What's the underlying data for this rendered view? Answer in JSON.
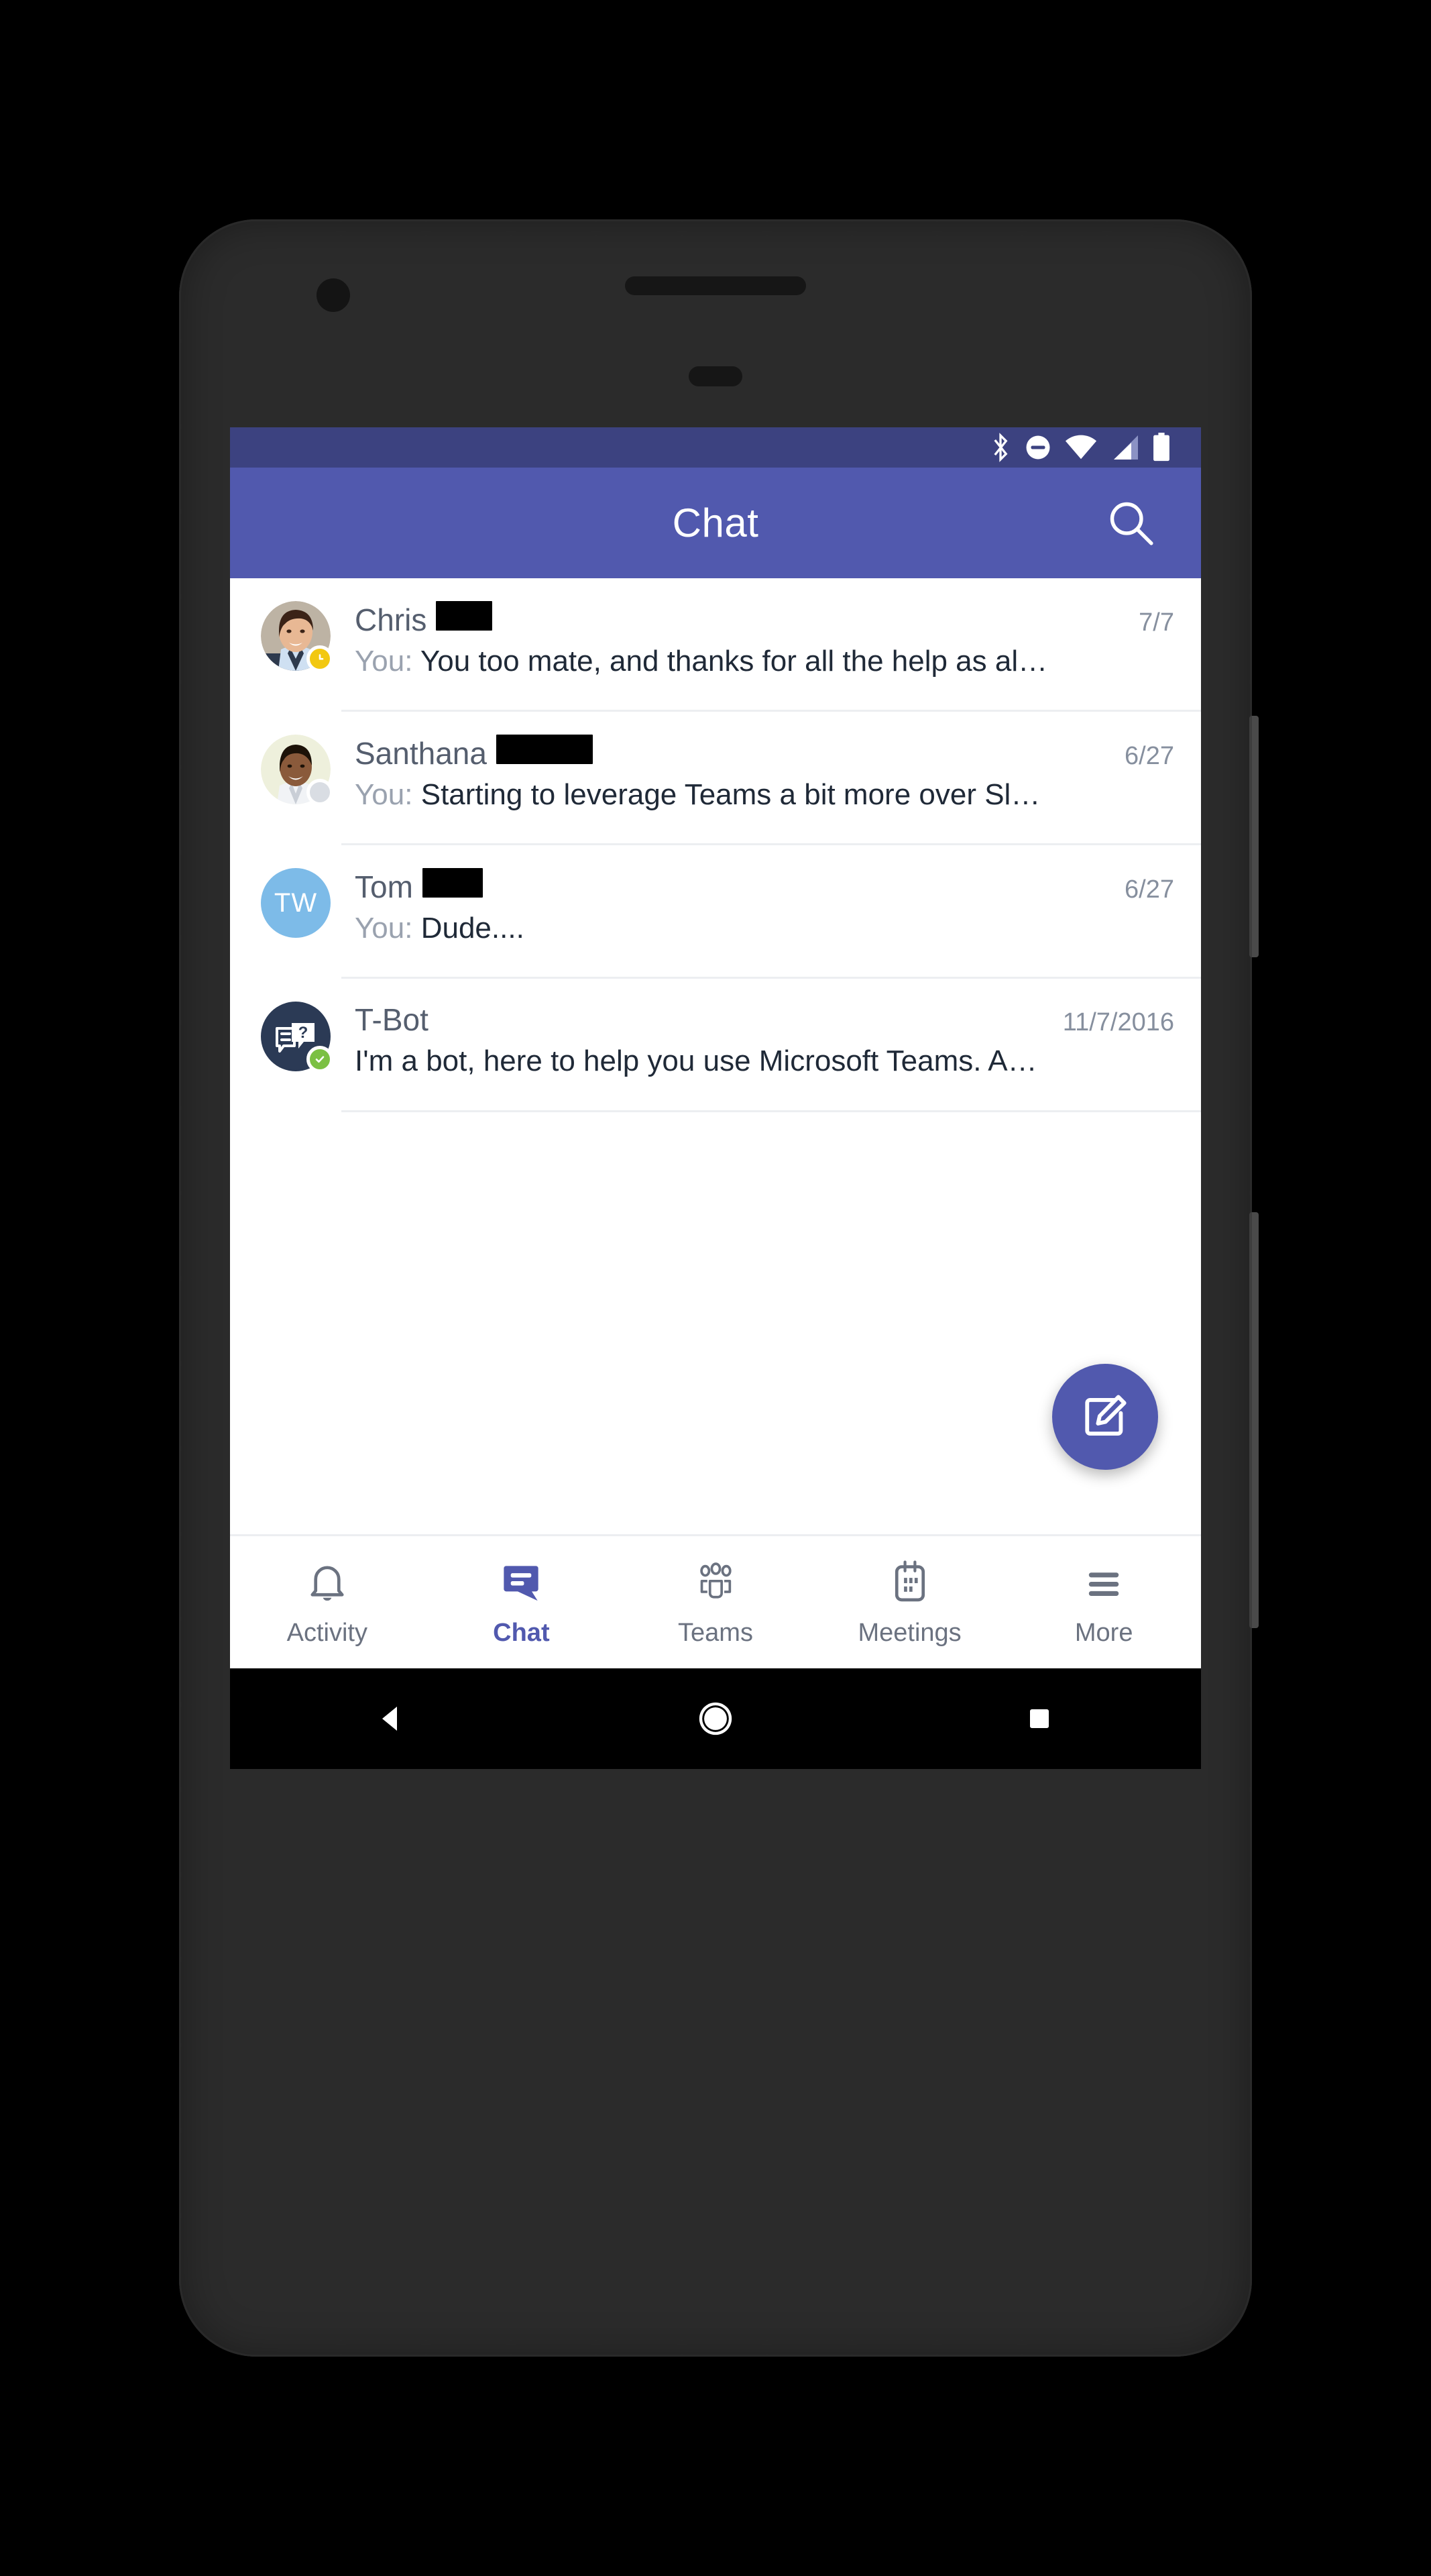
{
  "statusbar": {
    "icons": [
      "bluetooth-icon",
      "do-not-disturb-icon",
      "wifi-icon",
      "cellular-signal-icon",
      "battery-icon"
    ],
    "background": "#3c4280"
  },
  "appbar": {
    "title": "Chat",
    "search_icon": "search-icon",
    "background": "#5159ae"
  },
  "chat_list": [
    {
      "name": "Chris",
      "redacted": true,
      "redact_width": 84,
      "date": "7/7",
      "preview_prefix": "You:",
      "preview": "You too mate, and thanks for all the help as al…",
      "avatar_type": "photo",
      "avatar_initials": "",
      "presence": "away",
      "presence_color": "#f2c811"
    },
    {
      "name": "Santhana",
      "redacted": true,
      "redact_width": 144,
      "date": "6/27",
      "preview_prefix": "You:",
      "preview": "Starting to leverage Teams a bit more over Sl…",
      "avatar_type": "photo",
      "avatar_initials": "",
      "presence": "offline",
      "presence_color": "#d9dde3"
    },
    {
      "name": "Tom",
      "redacted": true,
      "redact_width": 90,
      "date": "6/27",
      "preview_prefix": "You:",
      "preview": "Dude....",
      "avatar_type": "initials",
      "avatar_initials": "TW",
      "presence": "none",
      "presence_color": ""
    },
    {
      "name": "T-Bot",
      "redacted": false,
      "redact_width": 0,
      "date": "11/7/2016",
      "preview_prefix": "",
      "preview": "I'm a bot, here to help you use Microsoft Teams.  A…",
      "avatar_type": "bot",
      "avatar_initials": "",
      "presence": "online",
      "presence_color": "#7bc043"
    }
  ],
  "fab": {
    "label": "compose-chat",
    "icon": "compose-icon",
    "color": "#5159ae"
  },
  "bottomnav": {
    "items": [
      {
        "label": "Activity",
        "icon": "bell-icon",
        "active": false
      },
      {
        "label": "Chat",
        "icon": "chat-icon",
        "active": true
      },
      {
        "label": "Teams",
        "icon": "people-icon",
        "active": false
      },
      {
        "label": "Meetings",
        "icon": "calendar-icon",
        "active": false
      },
      {
        "label": "More",
        "icon": "hamburger-icon",
        "active": false
      }
    ],
    "active_color": "#5159ae",
    "inactive_color": "#6b7280"
  },
  "androidnav": {
    "buttons": [
      "back-button",
      "home-button",
      "recents-button"
    ]
  }
}
